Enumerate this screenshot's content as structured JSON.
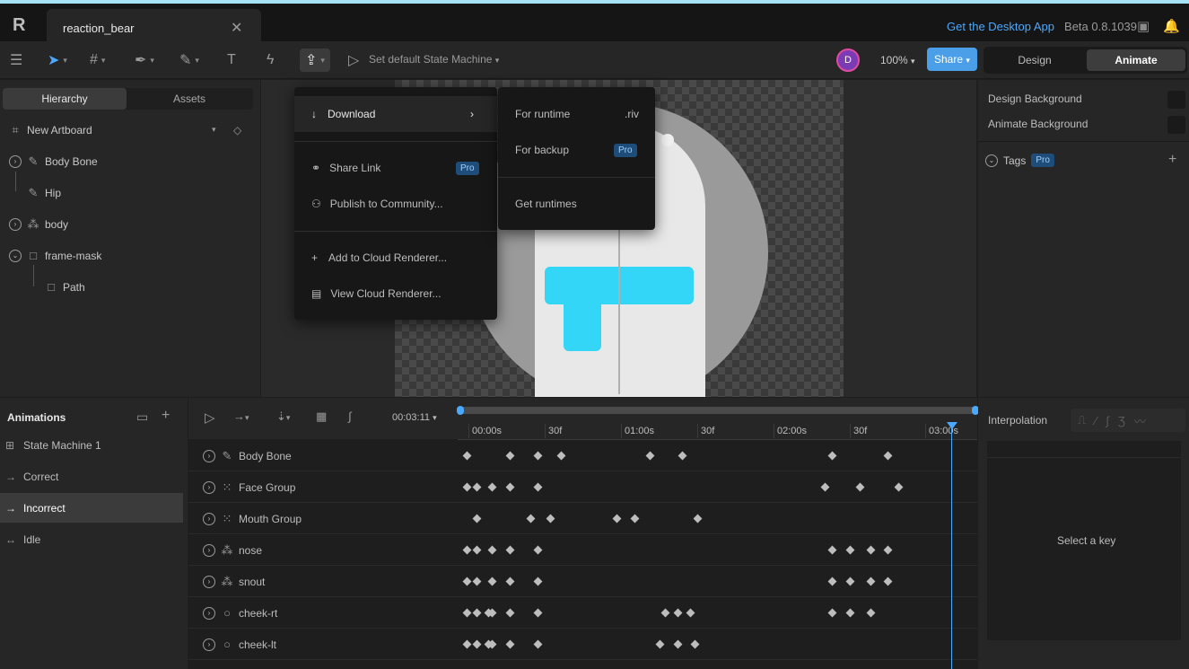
{
  "titlebar": {
    "file_name": "reaction_bear",
    "close_glyph": "✕",
    "desktop_link": "Get the Desktop App",
    "version": "Beta 0.8.1039"
  },
  "toolbar": {
    "state_machine_label": "Set default State Machine",
    "avatar_letter": "D",
    "zoom": "100%",
    "share_label": "Share",
    "design_label": "Design",
    "animate_label": "Animate"
  },
  "left_panel": {
    "tabs": [
      "Hierarchy",
      "Assets"
    ],
    "artboard": "New Artboard",
    "tree": [
      {
        "label": "Body Bone",
        "icon": "bone-icon"
      },
      {
        "label": "Hip",
        "icon": "bone-icon"
      },
      {
        "label": "body",
        "icon": "shapes-icon"
      },
      {
        "label": "frame-mask",
        "icon": "square-icon"
      },
      {
        "label": "Path",
        "icon": "square-icon"
      }
    ]
  },
  "share_menu": {
    "items": [
      "Download",
      "Share Link",
      "Publish to Community...",
      "Add to Cloud Renderer...",
      "View Cloud Renderer..."
    ],
    "pro_badge": "Pro",
    "submenu": {
      "runtime_label": "For runtime",
      "runtime_ext": ".riv",
      "backup_label": "For backup",
      "get_runtimes": "Get runtimes"
    }
  },
  "right_panel": {
    "design_bg": "Design Background",
    "animate_bg": "Animate Background",
    "tags_label": "Tags"
  },
  "animations": {
    "header": "Animations",
    "items": [
      {
        "label": "State Machine 1",
        "icon": "state-machine-icon",
        "arrow": ""
      },
      {
        "label": "Correct",
        "arrow": "→"
      },
      {
        "label": "Incorrect",
        "arrow": "→"
      },
      {
        "label": "Idle",
        "arrow": "↔"
      }
    ]
  },
  "timeline": {
    "time": "00:03:11",
    "ruler": [
      "00:00s",
      "30f",
      "01:00s",
      "30f",
      "02:00s",
      "30f",
      "03:00s"
    ],
    "tracks": [
      {
        "label": "Body Bone",
        "icon": "bone-icon",
        "keys": [
          520,
          568,
          599,
          625,
          724,
          760,
          927,
          989
        ]
      },
      {
        "label": "Face Group",
        "icon": "group-icon",
        "keys": [
          520,
          531,
          548,
          568,
          599,
          919,
          958,
          1001
        ]
      },
      {
        "label": "Mouth Group",
        "icon": "group-icon",
        "keys": [
          531,
          591,
          613,
          687,
          707,
          777
        ]
      },
      {
        "label": "nose",
        "icon": "shapes-icon",
        "keys": [
          520,
          531,
          548,
          568,
          599,
          927,
          947,
          970,
          989
        ]
      },
      {
        "label": "snout",
        "icon": "shapes-icon",
        "keys": [
          520,
          531,
          548,
          568,
          599,
          927,
          947,
          970,
          989
        ]
      },
      {
        "label": "cheek-rt",
        "icon": "circle-icon",
        "keys": [
          520,
          531,
          544,
          548,
          568,
          599,
          741,
          755,
          769,
          927,
          947,
          970
        ]
      },
      {
        "label": "cheek-lt",
        "icon": "circle-icon",
        "keys": [
          520,
          531,
          544,
          548,
          568,
          599,
          735,
          755,
          774
        ]
      }
    ]
  },
  "interpolation": {
    "header": "Interpolation",
    "empty_state": "Select a key"
  },
  "colors": {
    "accent": "#4aa8ff",
    "belt": "#33d6f7",
    "avatar": "#7a3bb5"
  }
}
